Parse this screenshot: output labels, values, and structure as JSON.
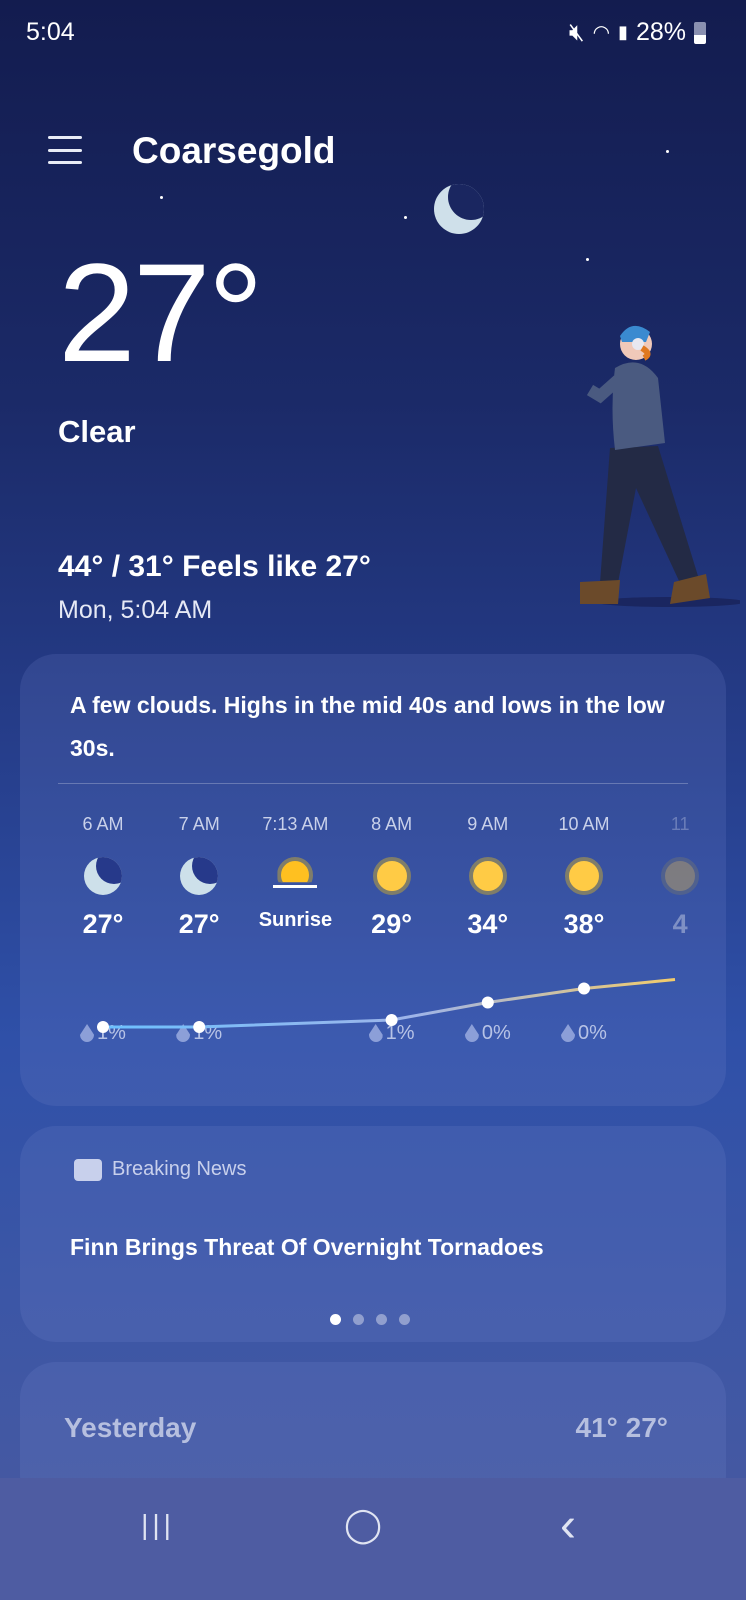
{
  "status": {
    "time": "5:04",
    "battery": "28%",
    "icons": [
      "mute-icon",
      "wifi-icon",
      "signal-icon",
      "battery-icon"
    ]
  },
  "header": {
    "city": "Coarsegold",
    "menu_icon": "hamburger-icon"
  },
  "current": {
    "temp": "27°",
    "condition": "Clear",
    "hilo": "44° / 31° Feels like 27°",
    "date": "Mon, 5:04 AM"
  },
  "forecast": {
    "summary": "A few clouds. Highs in the mid 40s and lows in the low 30s.",
    "hourly": [
      {
        "time": "6 AM",
        "icon": "moon",
        "temp": "27°",
        "value": 27,
        "precip": "1%"
      },
      {
        "time": "7 AM",
        "icon": "moon",
        "temp": "27°",
        "value": 27,
        "precip": "1%"
      },
      {
        "time": "7:13 AM",
        "icon": "sunrise",
        "temp": "Sunrise",
        "value": null,
        "precip": ""
      },
      {
        "time": "8 AM",
        "icon": "sun",
        "temp": "29°",
        "value": 29,
        "precip": "1%"
      },
      {
        "time": "9 AM",
        "icon": "sun",
        "temp": "34°",
        "value": 34,
        "precip": "0%"
      },
      {
        "time": "10 AM",
        "icon": "sun",
        "temp": "38°",
        "value": 38,
        "precip": "0%"
      },
      {
        "time": "11",
        "icon": "sun",
        "temp": "4",
        "value": null,
        "precip": ""
      }
    ]
  },
  "news": {
    "label": "Breaking News",
    "title": "Finn Brings Threat Of Overnight Tornadoes",
    "pages": 4,
    "active_page": 1
  },
  "yesterday": {
    "label": "Yesterday",
    "temps": "41° 27°"
  },
  "nav": {
    "recents": "|||",
    "home": "◯",
    "back": "‹"
  }
}
